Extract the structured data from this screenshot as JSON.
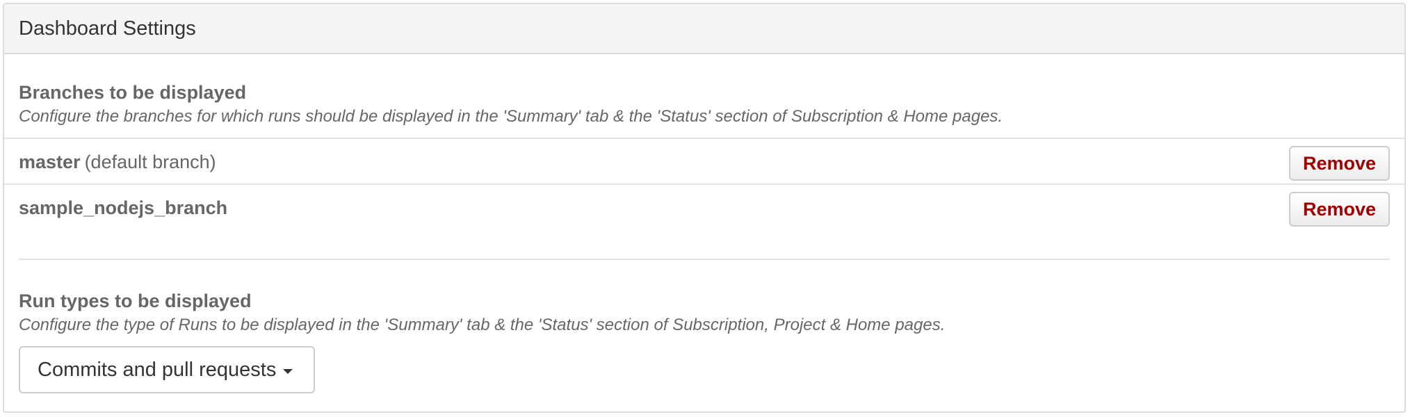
{
  "panel": {
    "title": "Dashboard Settings"
  },
  "branches_section": {
    "title": "Branches to be displayed",
    "description": "Configure the branches for which runs should be displayed in the 'Summary' tab & the 'Status' section of Subscription & Home pages.",
    "items": [
      {
        "name": "master",
        "note": "(default branch)",
        "action_label": "Remove"
      },
      {
        "name": "sample_nodejs_branch",
        "note": "",
        "action_label": "Remove"
      }
    ]
  },
  "run_types_section": {
    "title": "Run types to be displayed",
    "description": "Configure the type of Runs to be displayed in the 'Summary' tab & the 'Status' section of Subscription, Project & Home pages.",
    "selected_option": "Commits and pull requests"
  },
  "colors": {
    "remove_text": "#a00000",
    "header_bg": "#f5f5f5",
    "border": "#dcdcdc"
  },
  "icons": {
    "dropdown": "caret-down-icon"
  }
}
